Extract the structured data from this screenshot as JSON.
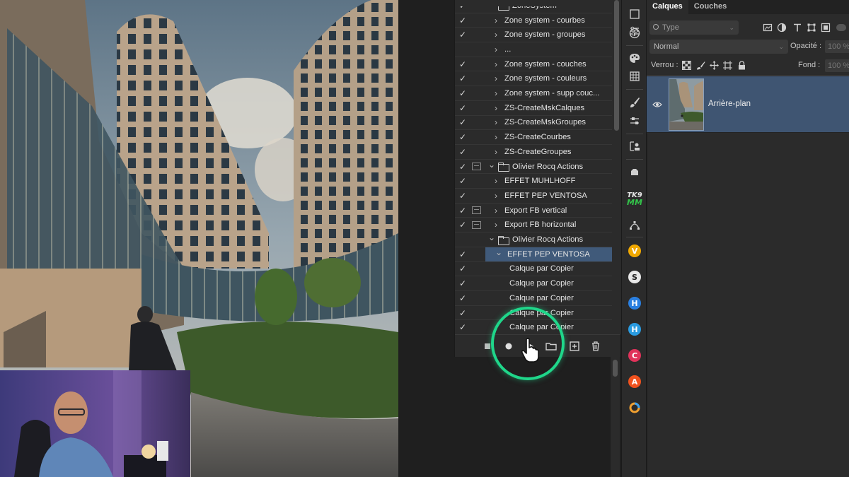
{
  "actions_panel": {
    "rows": [
      {
        "label": "ZoneSystem",
        "check": true,
        "dialog": false,
        "indent": 0,
        "type": "set",
        "expanded": true
      },
      {
        "label": "Zone system - courbes",
        "check": true,
        "dialog": false,
        "indent": 1,
        "type": "action"
      },
      {
        "label": "Zone system - groupes",
        "check": true,
        "dialog": false,
        "indent": 1,
        "type": "action"
      },
      {
        "label": "...",
        "check": false,
        "dialog": false,
        "indent": 1,
        "type": "action"
      },
      {
        "label": "Zone system - couches",
        "check": true,
        "dialog": false,
        "indent": 1,
        "type": "action"
      },
      {
        "label": "Zone system - couleurs",
        "check": true,
        "dialog": false,
        "indent": 1,
        "type": "action"
      },
      {
        "label": "Zone system - supp couc...",
        "check": true,
        "dialog": false,
        "indent": 1,
        "type": "action"
      },
      {
        "label": "ZS-CreateMskCalques",
        "check": true,
        "dialog": false,
        "indent": 1,
        "type": "action"
      },
      {
        "label": "ZS-CreateMskGroupes",
        "check": true,
        "dialog": false,
        "indent": 1,
        "type": "action"
      },
      {
        "label": "ZS-CreateCourbes",
        "check": true,
        "dialog": false,
        "indent": 1,
        "type": "action"
      },
      {
        "label": "ZS-CreateGroupes",
        "check": true,
        "dialog": false,
        "indent": 1,
        "type": "action"
      },
      {
        "label": "Olivier Rocq Actions",
        "check": true,
        "dialog": true,
        "indent": 0,
        "type": "set",
        "expanded": true
      },
      {
        "label": "EFFET MUHLHOFF",
        "check": true,
        "dialog": false,
        "indent": 1,
        "type": "action"
      },
      {
        "label": "EFFET PEP VENTOSA",
        "check": true,
        "dialog": false,
        "indent": 1,
        "type": "action"
      },
      {
        "label": "Export FB vertical",
        "check": true,
        "dialog": true,
        "indent": 1,
        "type": "action"
      },
      {
        "label": "Export FB horizontal",
        "check": true,
        "dialog": true,
        "indent": 1,
        "type": "action"
      },
      {
        "label": "Olivier Rocq Actions",
        "check": false,
        "dialog": false,
        "indent": 0,
        "type": "set",
        "expanded": true
      },
      {
        "label": "EFFET PEP VENTOSA",
        "check": true,
        "dialog": false,
        "indent": 1,
        "type": "action",
        "expanded": true,
        "selected": true
      },
      {
        "label": "Calque par Copier",
        "check": true,
        "dialog": false,
        "indent": 2,
        "type": "step"
      },
      {
        "label": "Calque par Copier",
        "check": true,
        "dialog": false,
        "indent": 2,
        "type": "step"
      },
      {
        "label": "Calque par Copier",
        "check": true,
        "dialog": false,
        "indent": 2,
        "type": "step"
      },
      {
        "label": "Calque par Copier",
        "check": true,
        "dialog": false,
        "indent": 2,
        "type": "step"
      },
      {
        "label": "Calque par Copier",
        "check": true,
        "dialog": false,
        "indent": 2,
        "type": "step"
      },
      {
        "label": "Calque par Copier",
        "check": true,
        "dialog": false,
        "indent": 2,
        "type": "step"
      }
    ],
    "footer_buttons": [
      "stop-icon",
      "record-icon",
      "play-icon",
      "new-set-folder-icon",
      "new-action-icon",
      "trash-icon"
    ]
  },
  "toolbar_strip": {
    "badges": [
      {
        "name": "v-plugin-icon",
        "letter": "V",
        "color": "#f0a800"
      },
      {
        "name": "s-plugin-icon",
        "letter": "S",
        "color": "#e8e8e8"
      },
      {
        "name": "h-plugin-icon",
        "letter": "H",
        "color": "#2a7fe0"
      },
      {
        "name": "h2-plugin-icon",
        "letter": "H",
        "color": "#2a9be0"
      },
      {
        "name": "c-plugin-icon",
        "letter": "C",
        "color": "#e0325a"
      },
      {
        "name": "a-plugin-icon",
        "letter": "A",
        "color": "#f0521e"
      }
    ],
    "tk_label": "TK9",
    "mm_label": "MM"
  },
  "layers_panel": {
    "tabs": [
      "Calques",
      "Couches"
    ],
    "filter_placeholder": "Type",
    "blend_mode": "Normal",
    "opacity_label": "Opacité :",
    "opacity_value": "100 %",
    "lock_label": "Verrou :",
    "fill_label": "Fond :",
    "fill_value": "100 %",
    "layer": {
      "name": "Arrière-plan",
      "visible": true
    }
  },
  "colors": {
    "accent_ring": "#1fd68a",
    "selection": "#405a7a",
    "layer_selected": "#3f5572"
  }
}
